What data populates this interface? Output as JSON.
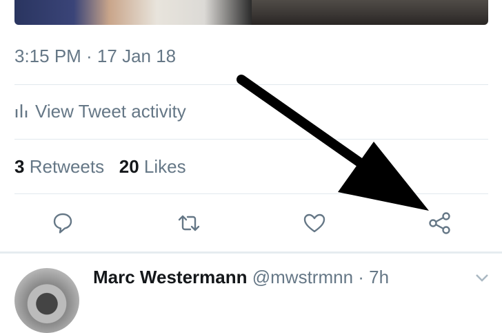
{
  "tweet": {
    "timestamp": "3:15 PM · 17 Jan 18",
    "activity_label": "View Tweet activity",
    "retweets_count": "3",
    "retweets_label": "Retweets",
    "likes_count": "20",
    "likes_label": "Likes"
  },
  "actions": [
    "reply-icon",
    "retweet-icon",
    "like-icon",
    "share-icon"
  ],
  "next_tweet": {
    "name": "Marc Westermann",
    "handle": "@mwstrmnn",
    "time": "· 7h"
  }
}
